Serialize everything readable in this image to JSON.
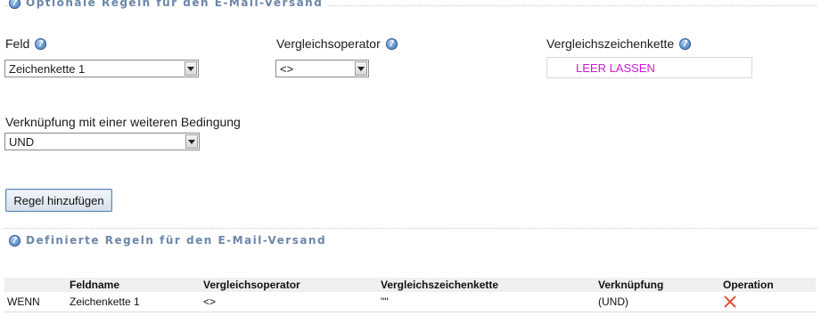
{
  "section_optional": {
    "title": "Optionale Regeln für den E-Mail-Versand",
    "feld_label": "Feld",
    "feld_value": "Zeichenkette 1",
    "operator_label": "Vergleichsoperator",
    "operator_value": "<>",
    "compare_label": "Vergleichszeichenkette",
    "compare_value": "LEER LASSEN",
    "link_label": "Verknüpfung mit einer weiteren Bedingung",
    "link_value": "UND",
    "add_button": "Regel hinzufügen"
  },
  "section_defined": {
    "title": "Definierte Regeln für den E-Mail-Versand",
    "columns": [
      "",
      "Feldname",
      "Vergleichsoperator",
      "Vergleichszeichenkette",
      "Verknüpfung",
      "Operation"
    ],
    "rows": [
      {
        "prefix": "WENN",
        "feldname": "Zeichenkette 1",
        "operator": "<>",
        "compare": "\"\"",
        "link": "(UND)",
        "operation_icon": "delete-x-icon"
      }
    ]
  },
  "icons": {
    "help": "help-question-icon",
    "delete": "delete-x-icon"
  },
  "colors": {
    "legend": "#6b86a8",
    "placeholder": "#d21ad2",
    "delete": "#e0401a",
    "button_border": "#5d87b8"
  }
}
